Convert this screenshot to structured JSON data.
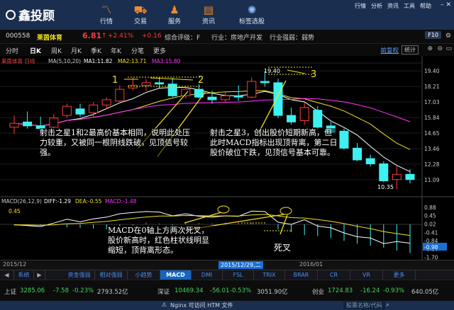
{
  "header": {
    "logo": "鑫投顾",
    "nav": [
      {
        "label": "行情",
        "icon": "chart-line-icon"
      },
      {
        "label": "交易",
        "icon": "cart-icon"
      },
      {
        "label": "服务",
        "icon": "user-icon"
      },
      {
        "label": "资讯",
        "icon": "news-icon"
      },
      {
        "label": "标签选股",
        "icon": "tag-icon"
      }
    ],
    "top_menu": [
      "行情",
      "分析",
      "资讯",
      "工具",
      "帮助"
    ]
  },
  "stock": {
    "code": "000558",
    "name": "莱茵体育",
    "price": "6.81",
    "arrow": "↑",
    "pct": "+2.41%",
    "chg": "+0.16",
    "rating_label": "综合评级：F",
    "industry_label": "行业：房地产开发",
    "strength_label": "行业强弱：弱势",
    "f10": "F10"
  },
  "period_tabs": [
    "分时",
    "日K",
    "周K",
    "月K",
    "季K",
    "年K",
    "分笔",
    "更多"
  ],
  "adjust_label": "前复权",
  "stat_label": "统计",
  "ma_legend": {
    "name": "莱茵体育 日线",
    "ma": "MA(5,10,20)",
    "ma1": "MA1:11.82",
    "ma2": "MA2:13.71",
    "ma3": "MA3:15.80"
  },
  "price_axis": [
    "19.40",
    "18.21",
    "17.03",
    "15.84",
    "14.65",
    "13.46",
    "12.28",
    "11.09"
  ],
  "high_label": "19.40",
  "low_label": "10.35",
  "labels_123": [
    "1",
    "2",
    "3"
  ],
  "notes": {
    "note1": "射击之星1和2最高价基本相同，说明此处压力较重，又被同一根阴线跌破，见顶信号较强。",
    "note2": "射击之星3，创出股价短期新高，但此时MACD指标出现顶背离，第二日股价破位下跌，见顶信号基本可靠。",
    "note3": "MACD在0轴上方两次死叉，股价新高时，红色柱状线明显缩短，顶背离形态。",
    "note4": "死叉"
  },
  "macd_legend": {
    "name": "MACD(26,12,9)",
    "diff": "DIFF:-1.29",
    "dea": "DEA:-0.55",
    "macd": "MACD:-1.48"
  },
  "macd_axis": [
    "0.88",
    "0.45",
    "0.02",
    "-0.41",
    "-0.84",
    "-1.26",
    "-1.70"
  ],
  "macd_left_label": "0.45",
  "macd_current": "-0.98",
  "date_labels": [
    "2015/12",
    "2015/12/29,二",
    "2016/01"
  ],
  "bottom_tabs": [
    "系统",
    "资金强弱",
    "相对强弱",
    "小趋势",
    "MACD",
    "DMI",
    "FSL",
    "TRIX",
    "BRAR",
    "CR",
    "VR",
    "更多"
  ],
  "indices": [
    {
      "name": "上证",
      "value": "3285.06",
      "chg": "-7.58",
      "pct": "-0.23%",
      "amount": "2793.52亿"
    },
    {
      "name": "深证",
      "value": "10469.34",
      "chg": "-56.01",
      "pct": "-0.53%",
      "amount": "3051.90亿"
    },
    {
      "name": "创业",
      "value": "1724.83",
      "chg": "-16.24",
      "pct": "-0.93%",
      "amount": "640.05亿"
    }
  ],
  "status": {
    "center": "Nginx 可访问 HTM 文件",
    "search": "股票名称/代码"
  },
  "colors": {
    "up": "#ff3b3b",
    "down": "#3ff0f0",
    "ma1": "#ffffff",
    "ma2": "#f0e020",
    "ma3": "#ff30ff",
    "header": "#1a2f50",
    "accent": "#f08a2a"
  },
  "candles": [
    {
      "o": 15.1,
      "h": 16.0,
      "l": 14.6,
      "c": 15.4
    },
    {
      "o": 15.5,
      "h": 16.3,
      "l": 15.0,
      "c": 15.2
    },
    {
      "o": 15.2,
      "h": 15.9,
      "l": 14.7,
      "c": 15.0
    },
    {
      "o": 15.1,
      "h": 16.1,
      "l": 14.8,
      "c": 15.8
    },
    {
      "o": 16.0,
      "h": 16.9,
      "l": 15.8,
      "c": 16.7
    },
    {
      "o": 16.5,
      "h": 16.9,
      "l": 15.9,
      "c": 16.1
    },
    {
      "o": 16.2,
      "h": 17.0,
      "l": 15.9,
      "c": 16.8
    },
    {
      "o": 16.8,
      "h": 17.4,
      "l": 16.5,
      "c": 17.2
    },
    {
      "o": 17.1,
      "h": 18.3,
      "l": 16.9,
      "c": 18.0
    },
    {
      "o": 18.1,
      "h": 18.9,
      "l": 17.9,
      "c": 18.3
    },
    {
      "o": 18.3,
      "h": 18.8,
      "l": 17.9,
      "c": 18.5
    },
    {
      "o": 18.5,
      "h": 18.9,
      "l": 18.1,
      "c": 18.4
    },
    {
      "o": 18.4,
      "h": 18.9,
      "l": 17.4,
      "c": 17.5
    },
    {
      "o": 17.5,
      "h": 18.2,
      "l": 17.3,
      "c": 18.0
    },
    {
      "o": 18.0,
      "h": 18.4,
      "l": 17.3,
      "c": 17.4
    },
    {
      "o": 17.4,
      "h": 17.9,
      "l": 16.9,
      "c": 17.2
    },
    {
      "o": 17.2,
      "h": 17.8,
      "l": 17.0,
      "c": 17.5
    },
    {
      "o": 17.5,
      "h": 18.3,
      "l": 17.1,
      "c": 17.4
    },
    {
      "o": 17.4,
      "h": 18.9,
      "l": 17.3,
      "c": 18.6
    },
    {
      "o": 18.6,
      "h": 19.4,
      "l": 18.2,
      "c": 18.5
    },
    {
      "o": 18.5,
      "h": 18.8,
      "l": 15.8,
      "c": 16.0
    },
    {
      "o": 16.0,
      "h": 16.6,
      "l": 15.3,
      "c": 15.5
    },
    {
      "o": 15.6,
      "h": 17.0,
      "l": 15.3,
      "c": 16.6
    },
    {
      "o": 16.4,
      "h": 16.7,
      "l": 14.9,
      "c": 15.1
    },
    {
      "o": 15.2,
      "h": 15.5,
      "l": 14.6,
      "c": 14.7
    },
    {
      "o": 14.8,
      "h": 15.0,
      "l": 13.4,
      "c": 13.5
    },
    {
      "o": 13.5,
      "h": 13.9,
      "l": 12.5,
      "c": 12.6
    },
    {
      "o": 12.7,
      "h": 13.0,
      "l": 12.1,
      "c": 12.3
    },
    {
      "o": 12.3,
      "h": 12.5,
      "l": 10.9,
      "c": 11.0
    },
    {
      "o": 11.1,
      "h": 12.1,
      "l": 10.35,
      "c": 11.5
    },
    {
      "o": 11.5,
      "h": 11.9,
      "l": 10.8,
      "c": 11.1
    }
  ],
  "macd_bars": [
    -0.05,
    -0.06,
    -0.04,
    0.02,
    -0.15,
    -0.18,
    -0.22,
    -0.25,
    -0.1,
    -0.05,
    0.1,
    0.05,
    -0.05,
    0.12,
    0.08,
    0.05,
    0.1,
    0.15,
    0.08,
    0.02,
    -0.25,
    -0.4,
    -0.55,
    -0.6,
    -0.7,
    -0.85,
    -1.0,
    -1.1,
    -1.2,
    -1.35,
    -1.48
  ]
}
